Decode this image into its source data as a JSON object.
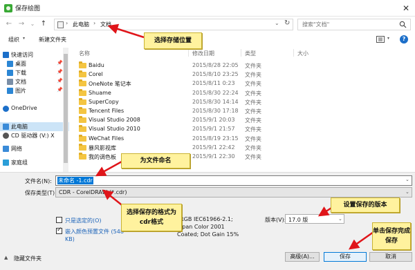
{
  "window": {
    "title": "保存绘图",
    "close": "✕"
  },
  "address": {
    "back": "←",
    "forward": "→",
    "recent": "⌄",
    "up": "↑",
    "sep": "›",
    "crumbs": [
      "此电脑",
      "文档"
    ],
    "dropdown": "⌄",
    "refresh": "↻"
  },
  "search": {
    "placeholder": "搜索\"文档\""
  },
  "toolbar": {
    "organize": "组织",
    "new_folder": "新建文件夹",
    "dd": "▾",
    "help": "?"
  },
  "nav": {
    "items": [
      {
        "label": "快速访问",
        "icon": "star-icon",
        "color": "#1c6fc9"
      },
      {
        "label": "桌面",
        "icon": "desktop-icon",
        "color": "#2b86d4",
        "pinned": true
      },
      {
        "label": "下载",
        "icon": "download-icon",
        "color": "#2b86d4",
        "pinned": true
      },
      {
        "label": "文档",
        "icon": "document-icon",
        "color": "#7a8ea6",
        "pinned": true
      },
      {
        "label": "图片",
        "icon": "picture-icon",
        "color": "#2b86d4",
        "pinned": true
      },
      {
        "label": "OneDrive",
        "icon": "cloud-icon",
        "color": "#1c6fc9"
      },
      {
        "label": "此电脑",
        "icon": "computer-icon",
        "color": "#3a8bd8"
      },
      {
        "label": "CD 驱动器 (V:) X",
        "icon": "disc-icon",
        "color": "#555555"
      },
      {
        "label": "网络",
        "icon": "network-icon",
        "color": "#3a8bd8"
      },
      {
        "label": "家庭组",
        "icon": "homegroup-icon",
        "color": "#2b9ed8"
      }
    ],
    "pin_glyph": "📌"
  },
  "columns": {
    "name": "名称",
    "date": "修改日期",
    "type": "类型",
    "size": "大小"
  },
  "files": [
    {
      "name": "Baidu",
      "date": "2015/8/28 22:05",
      "type": "文件夹"
    },
    {
      "name": "Corel",
      "date": "2015/8/10 23:25",
      "type": "文件夹"
    },
    {
      "name": "OneNote 笔记本",
      "date": "2015/8/11 0:23",
      "type": "文件夹"
    },
    {
      "name": "Shuame",
      "date": "2015/8/30 22:24",
      "type": "文件夹"
    },
    {
      "name": "SuperCopy",
      "date": "2015/8/30 14:14",
      "type": "文件夹"
    },
    {
      "name": "Tencent Files",
      "date": "2015/8/30 17:18",
      "type": "文件夹"
    },
    {
      "name": "Visual Studio 2008",
      "date": "2015/9/1 20:03",
      "type": "文件夹"
    },
    {
      "name": "Visual Studio 2010",
      "date": "2015/9/1 21:57",
      "type": "文件夹"
    },
    {
      "name": "WeChat Files",
      "date": "2015/8/19 23:15",
      "type": "文件夹"
    },
    {
      "name": "暴风影视库",
      "date": "2015/9/1 22:42",
      "type": "文件夹"
    },
    {
      "name": "我的调色板",
      "date": "2015/9/1 22:30",
      "type": "文件夹"
    }
  ],
  "form": {
    "filename_label": "文件名(N):",
    "filename_value": "未命名 -1.cdr",
    "type_label": "保存类型(T):",
    "type_value": "CDR - CorelDRAW (*.cdr)",
    "only_selected": "只是选定的(O)",
    "embed_profile": "嵌入颜色预置文件 (548 KB)",
    "profile_lines": [
      "sRGB IEC61966-2.1;",
      "Japan Color 2001",
      "Coated; Dot Gain 15%"
    ],
    "version_label": "版本(V):",
    "version_value": "17.0 版",
    "dd": "⌄"
  },
  "footer": {
    "hide_folders": "隐藏文件夹",
    "hide_arrow": "▲",
    "advanced": "高级(A)...",
    "save": "保存",
    "cancel": "取消"
  },
  "annotations": {
    "location": "选择存储位置",
    "naming": "为文件命名",
    "format": "选择保存的格式为cdr格式",
    "version": "设置保存的版本",
    "click_save": "单击保存完成保存"
  },
  "colors": {
    "callout_bg": "#fff29e",
    "arrow": "#e0151a",
    "selection": "#0078d7",
    "link_text": "#1a62b8"
  }
}
